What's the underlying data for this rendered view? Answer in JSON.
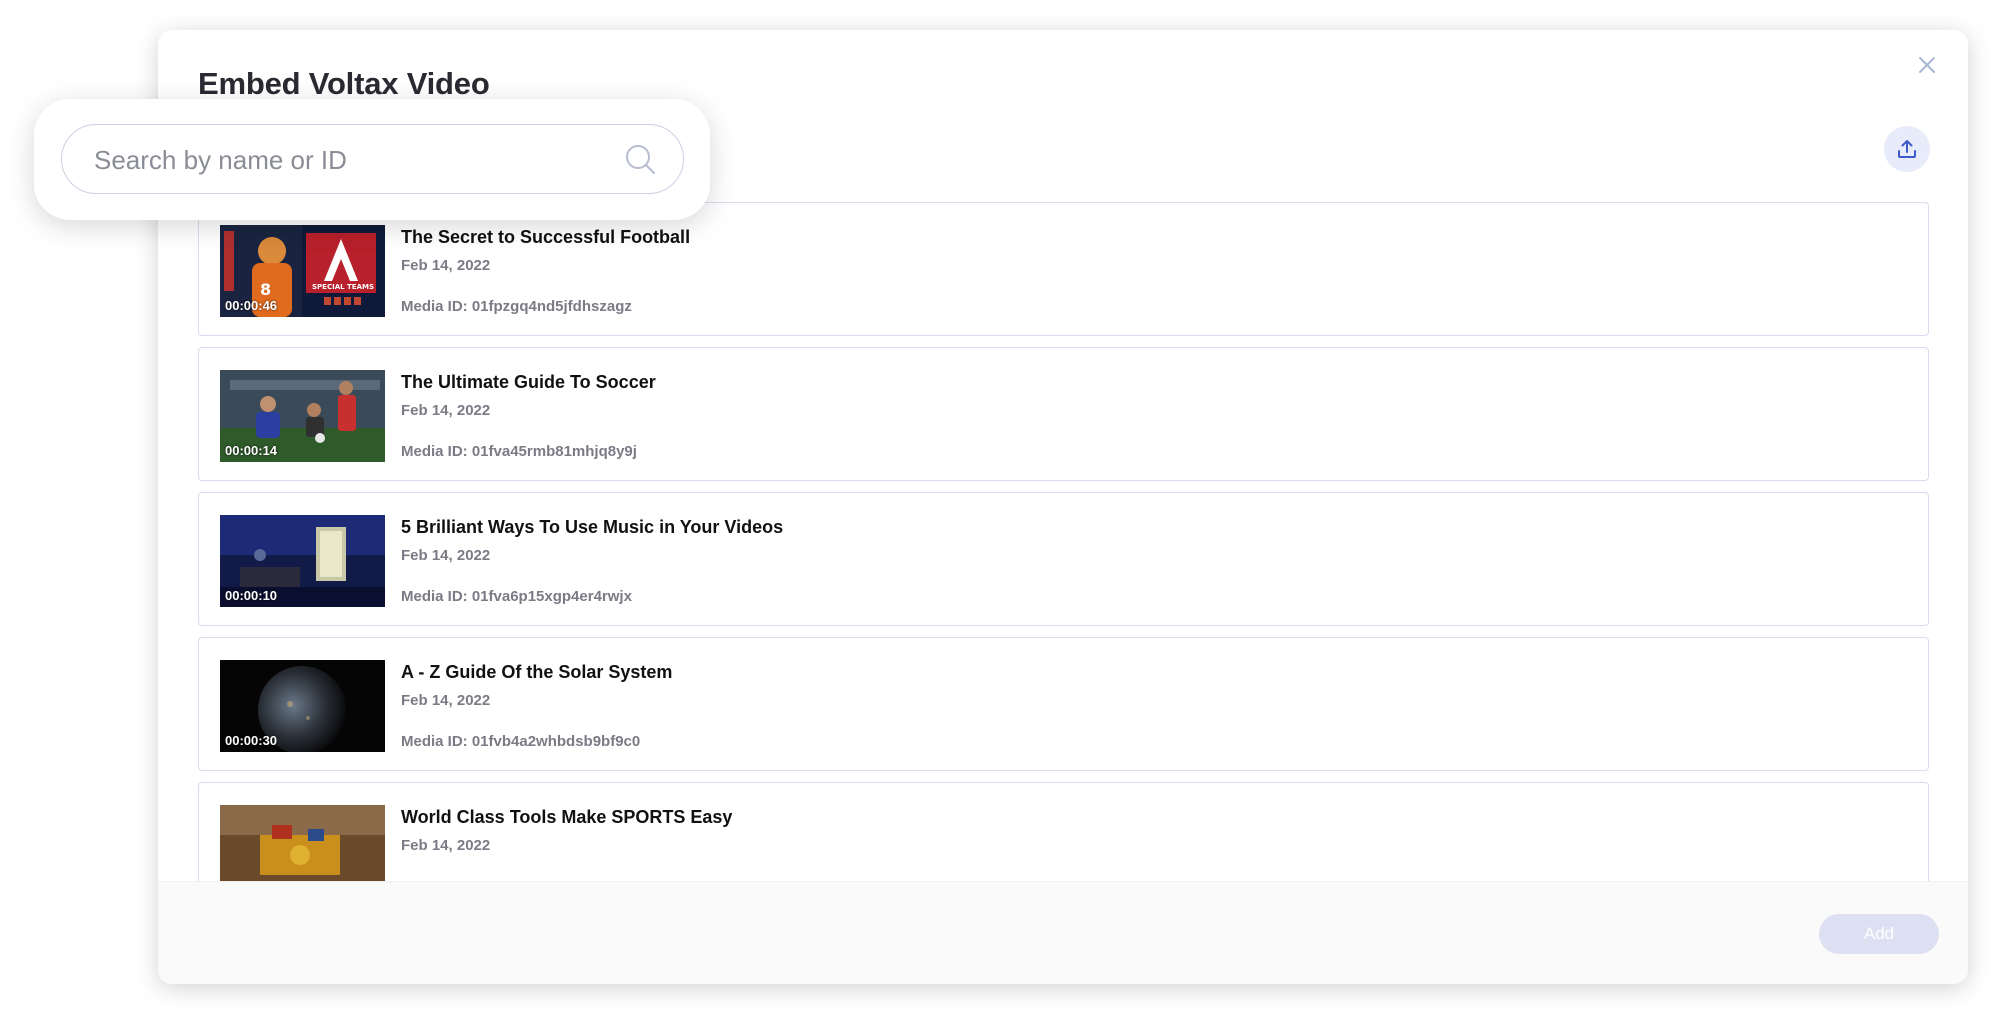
{
  "modal": {
    "title": "Embed Voltax Video"
  },
  "search": {
    "placeholder": "Search by name or ID",
    "value": ""
  },
  "icons": {
    "close": "close-icon",
    "upload": "upload-icon",
    "search": "search-icon"
  },
  "videos": [
    {
      "title": "The Secret to Successful Football",
      "date": "Feb 14, 2022",
      "media_id": "Media ID: 01fpzgq4nd5jfdhszagz",
      "duration": "00:00:46"
    },
    {
      "title": "The Ultimate Guide To Soccer",
      "date": "Feb 14, 2022",
      "media_id": "Media ID: 01fva45rmb81mhjq8y9j",
      "duration": "00:00:14"
    },
    {
      "title": "5 Brilliant Ways To Use Music in Your Videos",
      "date": "Feb 14, 2022",
      "media_id": "Media ID: 01fva6p15xgp4er4rwjx",
      "duration": "00:00:10"
    },
    {
      "title": "A - Z Guide Of the Solar System",
      "date": "Feb 14, 2022",
      "media_id": "Media ID: 01fvb4a2whbdsb9bf9c0",
      "duration": "00:00:30"
    },
    {
      "title": "World Class Tools Make SPORTS Easy",
      "date": "Feb 14, 2022",
      "media_id": "",
      "duration": ""
    }
  ],
  "footer": {
    "add_label": "Add"
  },
  "colors": {
    "accent": "#3d5ac9",
    "add_button_disabled": "#dde0f2",
    "upload_button_bg": "#e8ecfa",
    "border": "#d9dcec"
  }
}
